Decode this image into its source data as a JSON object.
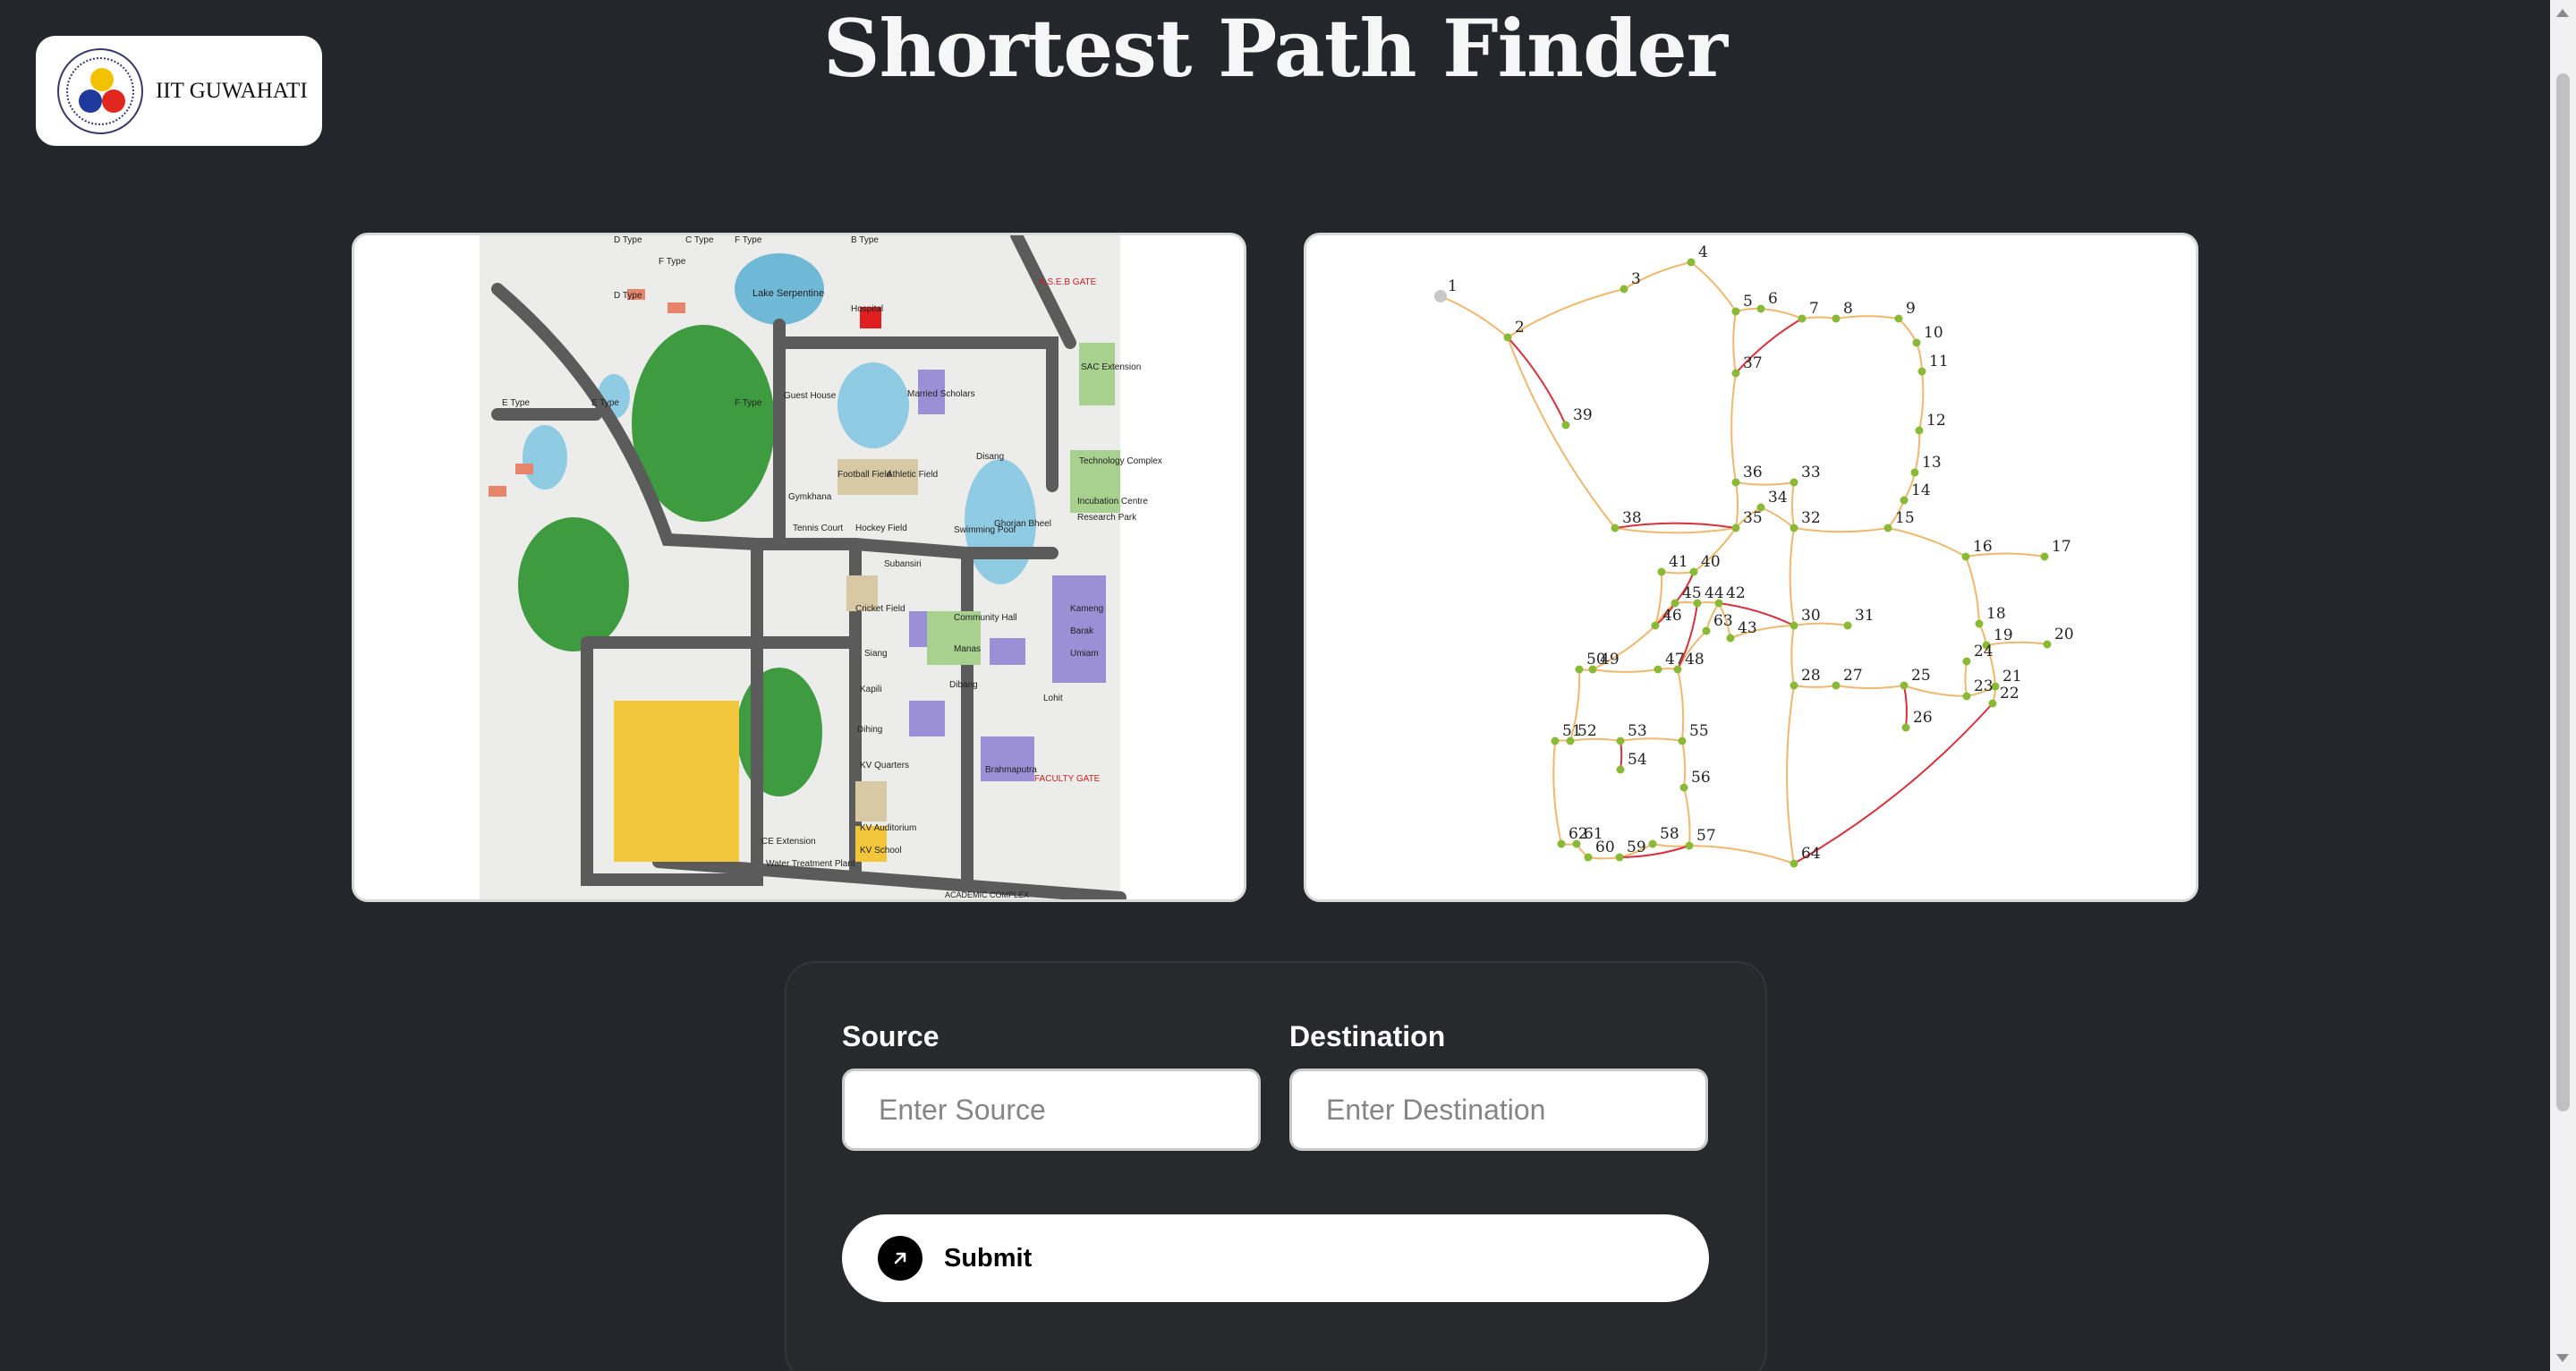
{
  "header": {
    "title": "Shortest Path Finder",
    "logo_text": "IIT GUWAHATI",
    "logo_icon": "iit-guwahati-seal"
  },
  "campus_map": {
    "labels": [
      "D Type",
      "C Type",
      "F Type",
      "B Type",
      "E Type",
      "Lake Serpentine",
      "Hospital",
      "A.S.E.B GATE",
      "Guest House",
      "Married Scholars",
      "SAC Extension",
      "Technology Complex",
      "Football Field",
      "Athletic Field",
      "Hockey Field",
      "Tennis Court",
      "Cricket Field",
      "Swimming Pool",
      "Gymkhana",
      "Siang",
      "Kapili",
      "Dihing",
      "Brahmaputra",
      "Manas",
      "Dibang",
      "Subansiri",
      "Disang",
      "Kameng",
      "Barak",
      "Umiam",
      "KV Quarters",
      "KV Auditorium",
      "KV School",
      "CE Extension",
      "Water Treatment Plant",
      "Lohit",
      "FACULTY GATE",
      "Community Hall",
      "Incubation Centre",
      "Research Park",
      "Ghorjan Bheel",
      "ACADEMIC COMPLEX"
    ]
  },
  "graph": {
    "node_labels": [
      "1",
      "2",
      "3",
      "4",
      "5",
      "6",
      "7",
      "8",
      "9",
      "10",
      "11",
      "12",
      "13",
      "14",
      "15",
      "16",
      "17",
      "18",
      "19",
      "20",
      "21",
      "22",
      "23",
      "24",
      "25",
      "26",
      "27",
      "28",
      "30",
      "31",
      "32",
      "33",
      "34",
      "35",
      "36",
      "37",
      "38",
      "39",
      "40",
      "41",
      "42",
      "43",
      "44",
      "45",
      "46",
      "47",
      "48",
      "49",
      "50",
      "51",
      "52",
      "53",
      "54",
      "55",
      "56",
      "57",
      "58",
      "59",
      "60",
      "61",
      "62",
      "63",
      "64"
    ],
    "colors": {
      "edge_main": "#f0b86e",
      "edge_alt": "#d8303c",
      "node": "#8ab935"
    }
  },
  "form": {
    "source_label": "Source",
    "source_placeholder": "Enter Source",
    "destination_label": "Destination",
    "destination_placeholder": "Enter Destination",
    "submit_label": "Submit",
    "submit_icon": "arrow-up-right-icon"
  }
}
